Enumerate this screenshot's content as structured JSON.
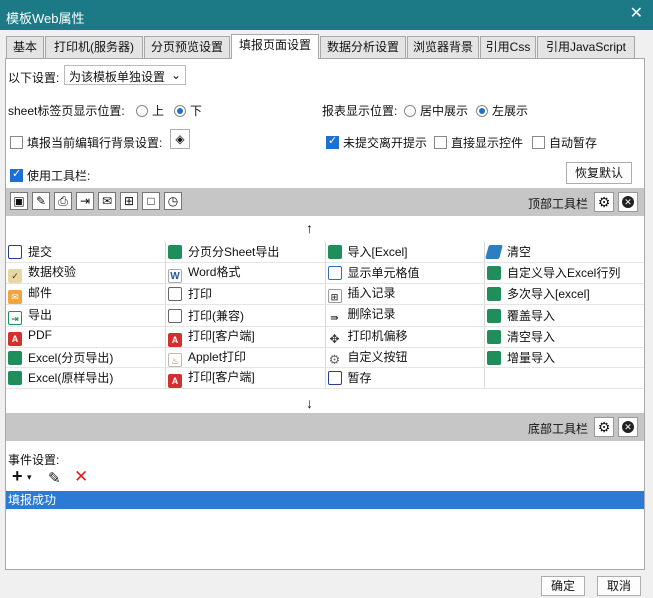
{
  "window": {
    "title": "模板Web属性",
    "close": "✕"
  },
  "tabs": [
    "基本",
    "打印机(服务器)",
    "分页预览设置",
    "填报页面设置",
    "数据分析设置",
    "浏览器背景",
    "引用Css",
    "引用JavaScript"
  ],
  "settings": {
    "scope_label": "以下设置:",
    "scope_value": "为该模板单独设置",
    "sheet_tab_label": "sheet标签页显示位置:",
    "sheet_top": "上",
    "sheet_bottom": "下",
    "report_pos_label": "报表显示位置:",
    "report_center": "居中展示",
    "report_left": "左展示",
    "row_bg_label": "填报当前编辑行背景设置:",
    "unsubmitted_leave": "未提交离开提示",
    "show_controls": "直接显示控件",
    "auto_stash": "自动暂存",
    "use_toolbar": "使用工具栏:",
    "restore_default": "恢复默认"
  },
  "top_toolbar": {
    "label": "顶部工具栏",
    "icons": [
      "save-icon",
      "check-icon",
      "print-icon",
      "export-icon",
      "mail-icon",
      "insert-row-icon",
      "cell-icon",
      "stash-icon"
    ],
    "glyphs": [
      "▣",
      "✎",
      "⎙",
      "⇥",
      "✉",
      "⊞",
      "□",
      "◷"
    ]
  },
  "up_arrow": "↑",
  "down_arrow": "↓",
  "button_grid": [
    [
      {
        "icon": "g-save",
        "text": "提交",
        "name": "save-icon"
      },
      {
        "icon": "g-green",
        "text": "分页分Sheet导出",
        "name": "excel-icon"
      },
      {
        "icon": "g-green",
        "text": "导入[Excel]",
        "name": "excel-icon"
      },
      {
        "icon": "g-erase",
        "text": "清空",
        "name": "eraser-icon"
      }
    ],
    [
      {
        "icon": "g-check",
        "text": "数据校验",
        "name": "check-icon",
        "glyph": "✓"
      },
      {
        "icon": "g-word",
        "text": "Word格式",
        "name": "word-icon",
        "glyph": "W"
      },
      {
        "icon": "g-cell",
        "text": "显示单元格值",
        "name": "cell-icon"
      },
      {
        "icon": "g-green",
        "text": "自定义导入Excel行列",
        "name": "excel-icon"
      }
    ],
    [
      {
        "icon": "g-mail",
        "text": "邮件",
        "name": "mail-icon",
        "glyph": "✉"
      },
      {
        "icon": "g-print",
        "text": "打印",
        "name": "print-icon"
      },
      {
        "icon": "g-insert",
        "text": "插入记录",
        "name": "insert-row-icon",
        "glyph": "⊞"
      },
      {
        "icon": "g-green",
        "text": "多次导入[excel]",
        "name": "excel-icon"
      }
    ],
    [
      {
        "icon": "g-export",
        "text": "导出",
        "name": "export-icon",
        "glyph": "⇥"
      },
      {
        "icon": "g-print",
        "text": "打印(兼容)",
        "name": "print-icon"
      },
      {
        "icon": "g-del",
        "text": "删除记录",
        "name": "delete-row-icon",
        "glyph": "⇛"
      },
      {
        "icon": "g-green",
        "text": "覆盖导入",
        "name": "excel-icon"
      }
    ],
    [
      {
        "icon": "g-pdf",
        "text": "PDF",
        "name": "pdf-icon",
        "glyph": "A"
      },
      {
        "icon": "g-pdf",
        "text": "打印[客户端]",
        "name": "pdf-icon",
        "glyph": "A"
      },
      {
        "icon": "g-move",
        "text": "打印机偏移",
        "name": "move-icon",
        "glyph": "✥"
      },
      {
        "icon": "g-green",
        "text": "清空导入",
        "name": "excel-icon"
      }
    ],
    [
      {
        "icon": "g-green",
        "text": "Excel(分页导出)",
        "name": "excel-icon"
      },
      {
        "icon": "g-java",
        "text": "Applet打印",
        "name": "java-icon",
        "glyph": "♨"
      },
      {
        "icon": "g-gear",
        "text": "自定义按钮",
        "name": "gear-icon",
        "glyph": "⚙"
      },
      {
        "icon": "g-green",
        "text": "增量导入",
        "name": "excel-icon"
      }
    ],
    [
      {
        "icon": "g-green",
        "text": "Excel(原样导出)",
        "name": "excel-icon"
      },
      {
        "icon": "g-pdf",
        "text": "打印[客户端]",
        "name": "pdf-icon",
        "glyph": "A"
      },
      {
        "icon": "g-stash",
        "text": "暂存",
        "name": "stash-icon"
      },
      {
        "icon": "",
        "text": "",
        "name": "empty"
      }
    ]
  ],
  "bottom_toolbar": {
    "label": "底部工具栏"
  },
  "events": {
    "label": "事件设置:",
    "add": "+",
    "add_caret": "▾",
    "edit": "✎",
    "delete": "✕",
    "items": [
      "填报成功"
    ]
  },
  "footer": {
    "ok": "确定",
    "cancel": "取消"
  },
  "colors": {
    "titlebar": "#1b7a86",
    "selection": "#2b7bd6",
    "accent": "#1f6fd1"
  }
}
